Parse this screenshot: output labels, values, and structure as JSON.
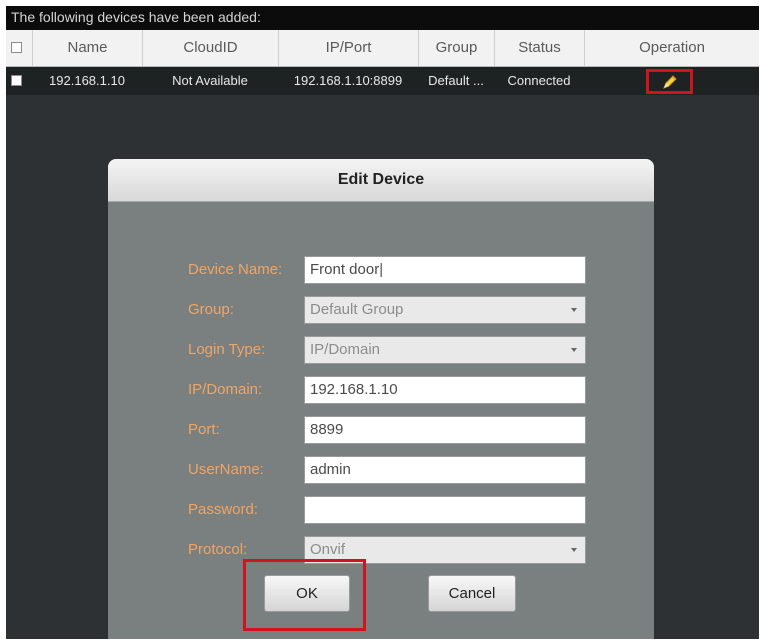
{
  "header": {
    "banner_text": "The following devices have been added:"
  },
  "table": {
    "columns": [
      "Name",
      "CloudID",
      "IP/Port",
      "Group",
      "Status",
      "Operation"
    ],
    "rows": [
      {
        "name": "192.168.1.10",
        "cloud_id": "Not Available",
        "ip_port": "192.168.1.10:8899",
        "group": "Default ...",
        "status": "Connected",
        "operation_icon": "pencil-icon"
      }
    ]
  },
  "dialog": {
    "title": "Edit Device",
    "fields": [
      {
        "label": "Device Name:",
        "value": "Front door",
        "type": "text"
      },
      {
        "label": "Group:",
        "value": "Default Group",
        "type": "select"
      },
      {
        "label": "Login Type:",
        "value": "IP/Domain",
        "type": "select"
      },
      {
        "label": "IP/Domain:",
        "value": "192.168.1.10",
        "type": "text"
      },
      {
        "label": "Port:",
        "value": "8899",
        "type": "text"
      },
      {
        "label": "UserName:",
        "value": "admin",
        "type": "text"
      },
      {
        "label": "Password:",
        "value": "",
        "type": "password"
      },
      {
        "label": "Protocol:",
        "value": "Onvif",
        "type": "select"
      }
    ],
    "ok_label": "OK",
    "cancel_label": "Cancel"
  },
  "colors": {
    "background": "#2d3133",
    "label_orange": "#f1a563",
    "highlight_red": "#d1131f",
    "dialog_body": "#7a7f80"
  }
}
